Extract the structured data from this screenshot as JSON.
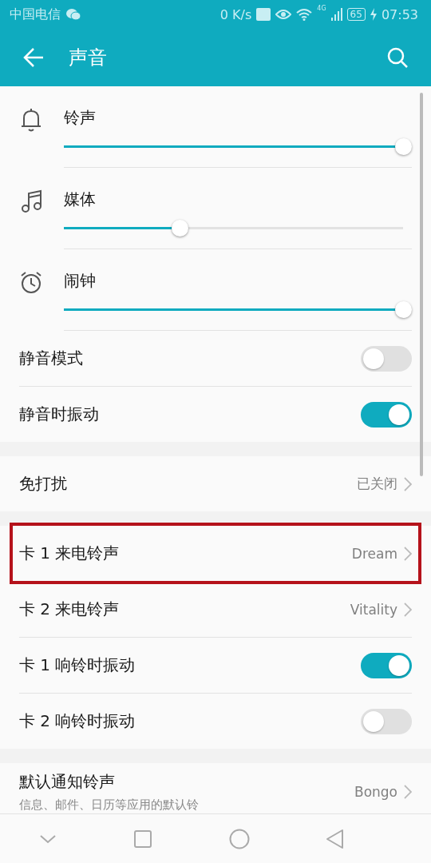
{
  "status_bar": {
    "carrier": "中国电信",
    "speed": "0 K/s",
    "network": "4G",
    "battery": "65",
    "time": "07:53"
  },
  "header": {
    "title": "声音"
  },
  "volumes": [
    {
      "kind": "bell",
      "label": "铃声",
      "level": 1.0
    },
    {
      "kind": "music",
      "label": "媒体",
      "level": 0.34
    },
    {
      "kind": "alarm",
      "label": "闹钟",
      "level": 1.0
    }
  ],
  "groups": [
    {
      "items": [
        {
          "kind": "toggle",
          "label": "静音模式",
          "on": false
        },
        {
          "kind": "toggle",
          "label": "静音时振动",
          "on": true
        }
      ]
    },
    {
      "items": [
        {
          "kind": "link",
          "label": "免打扰",
          "value": "已关闭",
          "highlighted": false
        }
      ]
    },
    {
      "items": [
        {
          "kind": "link",
          "label": "卡 1 来电铃声",
          "value": "Dream",
          "highlighted": true
        },
        {
          "kind": "link",
          "label": "卡 2 来电铃声",
          "value": "Vitality",
          "highlighted": false
        },
        {
          "kind": "toggle",
          "label": "卡 1 响铃时振动",
          "on": true
        },
        {
          "kind": "toggle",
          "label": "卡 2 响铃时振动",
          "on": false
        }
      ]
    },
    {
      "items": [
        {
          "kind": "link",
          "label": "默认通知铃声",
          "subtitle": "信息、邮件、日历等应用的默认铃",
          "value": "Bongo",
          "highlighted": false
        }
      ]
    }
  ]
}
